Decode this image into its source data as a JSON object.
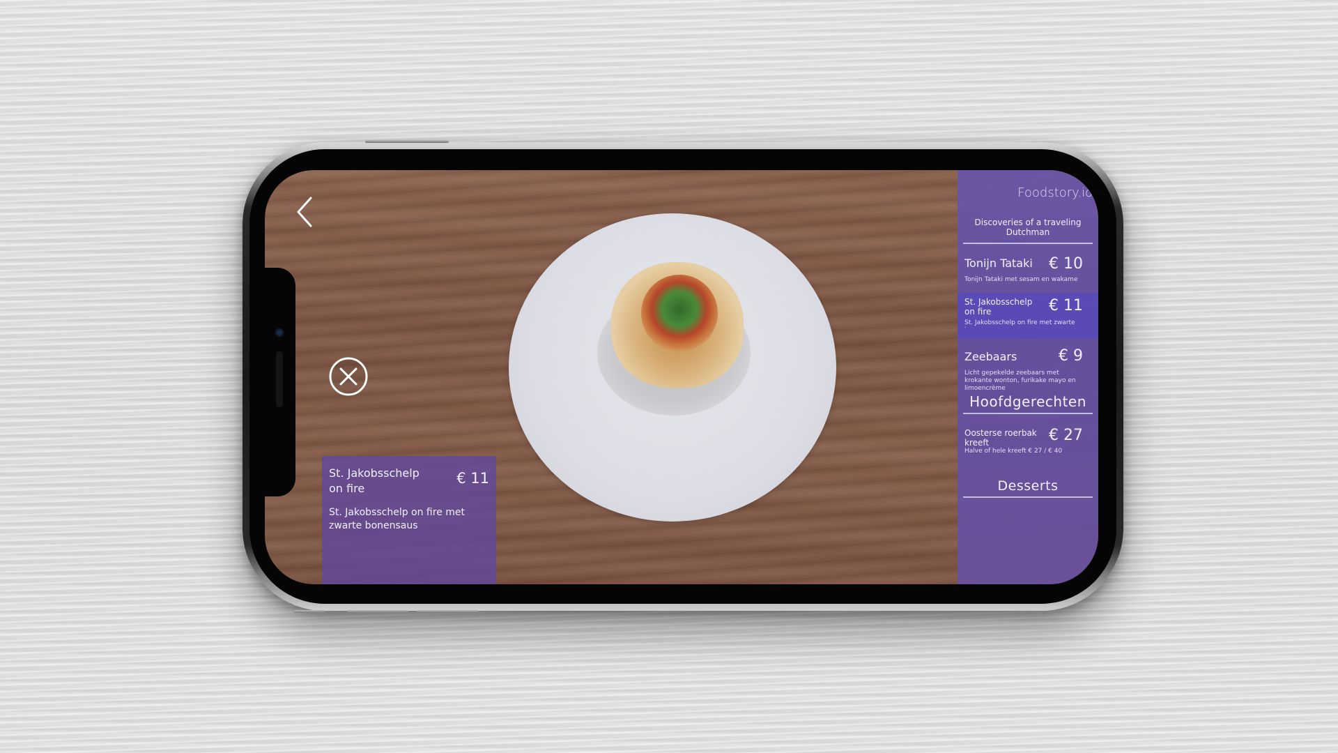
{
  "app": {
    "brand": "Foodstory.io",
    "tagline": "Discoveries of a traveling Dutchman"
  },
  "selected_dish": {
    "name": "St. Jakobsschelp on fire",
    "price": "€ 11",
    "description": "St. Jakobsschelp on fire met zwarte bonensaus"
  },
  "menu": {
    "items_top": [
      {
        "name": "Tonijn Tataki",
        "price": "€ 10",
        "description": "Tonijn Tataki met sesam en wakame"
      },
      {
        "name": "St. Jakobsschelp on fire",
        "price": "€ 11",
        "description": "St. Jakobsschelp on fire met zwarte bonensaus"
      },
      {
        "name": "Zeebaars",
        "price": "€ 9",
        "description": "Licht gepekelde zeebaars met krokante wonton, furikake mayo en limoencrème"
      }
    ],
    "sections": {
      "mains": "Hoofdgerechten",
      "desserts": "Desserts"
    },
    "items_mains": [
      {
        "name": "Oosterse roerbak kreeft",
        "price": "€ 27",
        "description": "Halve of hele kreeft € 27 / € 40"
      }
    ]
  },
  "icons": {
    "back": "chevron-left-icon",
    "close": "close-circle-icon"
  },
  "colors": {
    "panel": "#5f46a0",
    "highlight": "#5046c8"
  }
}
